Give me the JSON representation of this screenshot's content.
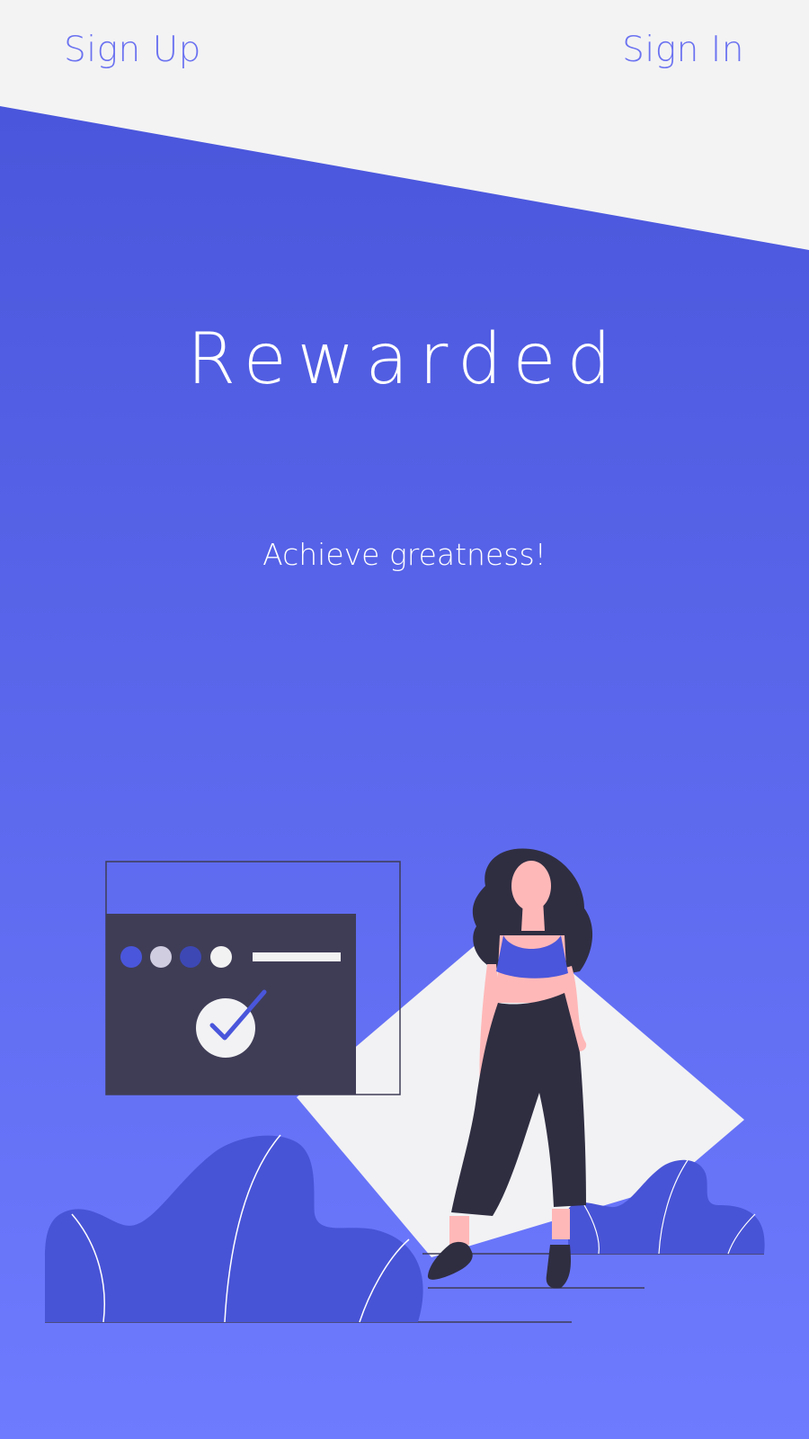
{
  "header": {
    "sign_up_label": "Sign Up",
    "sign_in_label": "Sign In"
  },
  "hero": {
    "title": "Rewarded",
    "tagline": "Achieve greatness!"
  },
  "colors": {
    "accent": "#6b72f0",
    "gradient_top": "#4a56db",
    "gradient_bottom": "#6f7bff",
    "light_bg": "#f3f3f4",
    "dark": "#2f2e41",
    "skin": "#ffb8b8"
  },
  "illustration": {
    "icons": [
      "browser-window-icon",
      "checkmark-icon",
      "woman-figure",
      "bush"
    ]
  }
}
